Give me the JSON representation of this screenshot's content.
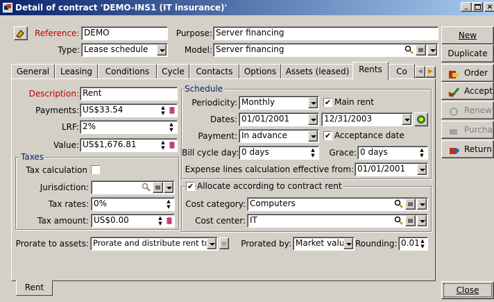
{
  "window": {
    "title": "Detail of contract 'DEMO-INS1 (IT insurance)'"
  },
  "header": {
    "reference_label": "Reference:",
    "reference_value": "DEMO",
    "type_label": "Type:",
    "type_value": "Lease schedule",
    "purpose_label": "Purpose:",
    "purpose_value": "Server financing",
    "model_label": "Model:",
    "model_value": "Server financing"
  },
  "tabs": [
    "General",
    "Leasing",
    "Conditions",
    "Cycle",
    "Contacts",
    "Options",
    "Assets (leased)",
    "Rents",
    "Co"
  ],
  "active_tab": "Rents",
  "left": {
    "description_label": "Description:",
    "description_value": "Rent",
    "payments_label": "Payments:",
    "payments_value": "US$33.54",
    "lrf_label": "LRF:",
    "lrf_value": "2%",
    "value_label": "Value:",
    "value_value": "US$1,676.81"
  },
  "taxes": {
    "title": "Taxes",
    "calc_label": "Tax calculation",
    "jurisdiction_label": "Jurisdiction:",
    "jurisdiction_value": "",
    "rates_label": "Tax rates:",
    "rates_value": "0%",
    "amount_label": "Tax amount:",
    "amount_value": "US$0.00"
  },
  "schedule": {
    "title": "Schedule",
    "periodicity_label": "Periodicity:",
    "periodicity_value": "Monthly",
    "main_rent_label": "Main rent",
    "main_rent_checked": true,
    "dates_label": "Dates:",
    "date_start": "01/01/2001",
    "date_end": "12/31/2003",
    "payment_label": "Payment:",
    "payment_value": "In advance",
    "acceptance_label": "Acceptance date",
    "acceptance_checked": true,
    "bill_label": "Bill cycle day:",
    "bill_value": "0 days",
    "grace_label": "Grace:",
    "grace_value": "0 days",
    "expense_label": "Expense lines calculation effective from:",
    "expense_value": "01/01/2001"
  },
  "allocate": {
    "label": "Allocate according to contract rent",
    "checked": true,
    "cost_category_label": "Cost category:",
    "cost_category_value": "Computers",
    "cost_center_label": "Cost center:",
    "cost_center_value": "IT"
  },
  "prorate": {
    "assets_label": "Prorate to assets:",
    "assets_value": "Prorate and distribute rent to al",
    "by_label": "Prorated by:",
    "by_value": "Market value",
    "rounding_label": "Rounding:",
    "rounding_value": "0.01"
  },
  "bottom_tab": "Rent",
  "side_buttons": {
    "new": "New",
    "duplicate": "Duplicate",
    "order": "Order",
    "accept": "Accept",
    "renew": "Renew",
    "purchase": "Purchase",
    "return": "Return",
    "close": "Close"
  },
  "colors": {
    "title_start": "#0a246a",
    "title_end": "#a6caf0",
    "required_label": "#c00000",
    "disabled_text": "#808080"
  }
}
